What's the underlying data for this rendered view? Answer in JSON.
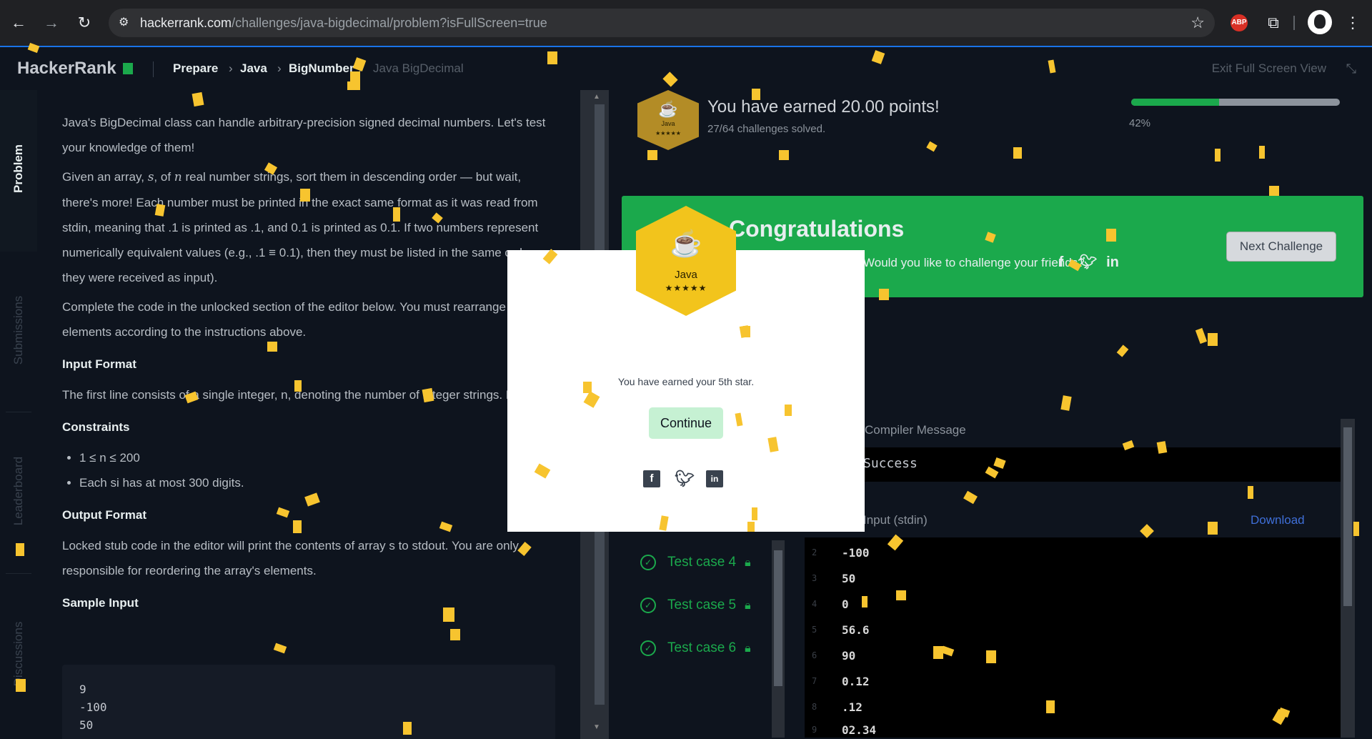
{
  "browser": {
    "url_host": "hackerrank.com",
    "url_path": "/challenges/java-bigdecimal/problem?isFullScreen=true",
    "abp_label": "ABP"
  },
  "topbar": {
    "logo": "HackerRank",
    "breadcrumbs": [
      "Prepare",
      "Java",
      "BigNumber",
      "Java BigDecimal"
    ],
    "exit_fullscreen": "Exit Full Screen View"
  },
  "sidetabs": [
    "Problem",
    "Submissions",
    "Leaderboard",
    "Discussions"
  ],
  "problem": {
    "p1": "Java's BigDecimal class can handle arbitrary-precision signed decimal numbers. Let's test your knowledge of them!",
    "p2a": "Given an array, ",
    "p2s": "s",
    "p2b": ", of ",
    "p2n": "n",
    "p2c": " real number strings, sort them in descending order — but wait, there's more! Each number must be printed in the exact same format as it was read from stdin, meaning that .1 is printed as .1, and 0.1 is printed as 0.1. If two numbers represent numerically equivalent values (e.g., .1 ≡ 0.1), then they must be listed in the same order as they were received as input).",
    "p3": "Complete the code in the unlocked section of the editor below. You must rearrange s's elements according to the instructions above.",
    "input_heading": "Input Format",
    "input_text": "The first line consists of a single integer, n, denoting the number of integer strings. Each line i of the n subsequent lines contains a real number denoting the value of",
    "constraints_heading": "Constraints",
    "constraints": [
      "1 ≤ n ≤ 200",
      "Each si has at most 300 digits."
    ],
    "output_heading": "Output Format",
    "output_text": "Locked stub code in the editor will print the contents of array s to stdout. You are only responsible for reordering the array's elements.",
    "sample_heading": "Sample Input",
    "sample_input": "9\n-100\n50"
  },
  "result": {
    "points_text": "You have earned 20.00 points!",
    "solved_text": "27/64 challenges solved.",
    "progress_percent": 42,
    "progress_label": "42%",
    "badge_name": "Java",
    "badge_stars": "★★★★★",
    "congrats_title": "Congratulations",
    "share_text": "Would you like to challenge your friends?",
    "next_button": "Next Challenge",
    "message_label": "Compiler Message",
    "message_value": "Success",
    "input_label": "Input (stdin)",
    "download_label": "Download",
    "test_cases": [
      "Test case 4",
      "Test case 5",
      "Test case 6"
    ],
    "input_lines": [
      {
        "n": "2",
        "v": "-100"
      },
      {
        "n": "3",
        "v": "50"
      },
      {
        "n": "4",
        "v": "0"
      },
      {
        "n": "5",
        "v": "56.6"
      },
      {
        "n": "6",
        "v": "90"
      },
      {
        "n": "7",
        "v": "0.12"
      },
      {
        "n": "8",
        "v": ".12"
      },
      {
        "n": "9",
        "v": "02.34"
      }
    ]
  },
  "modal": {
    "badge_name": "Java",
    "badge_stars": "★★★★★",
    "message": "You have earned your 5th star.",
    "continue_label": "Continue"
  },
  "colors": {
    "accent_green": "#1ba94c",
    "confetti": "#f7c42f",
    "background": "#0e141e"
  }
}
